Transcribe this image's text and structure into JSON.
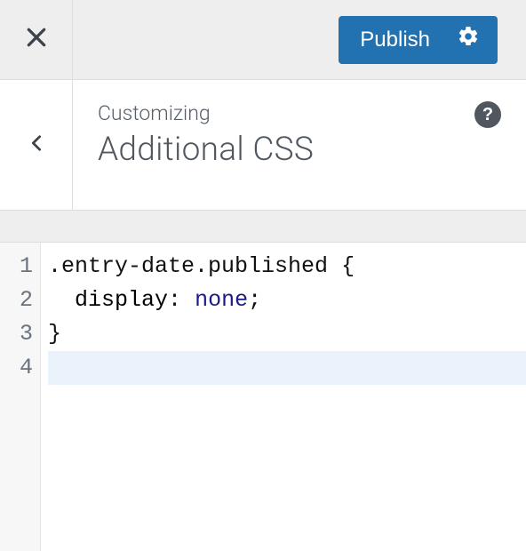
{
  "topbar": {
    "publish_label": "Publish"
  },
  "section": {
    "breadcrumb": "Customizing",
    "title": "Additional CSS",
    "help_label": "?"
  },
  "editor": {
    "line_numbers": [
      "1",
      "2",
      "3",
      "4"
    ],
    "lines": [
      {
        "selector": ".entry-date.published",
        "open": " {"
      },
      {
        "indent": "  ",
        "prop": "display",
        "colon": ": ",
        "value": "none",
        "semi": ";"
      },
      {
        "close": "}"
      },
      {
        "blank": ""
      }
    ],
    "active_line_index": 3
  }
}
